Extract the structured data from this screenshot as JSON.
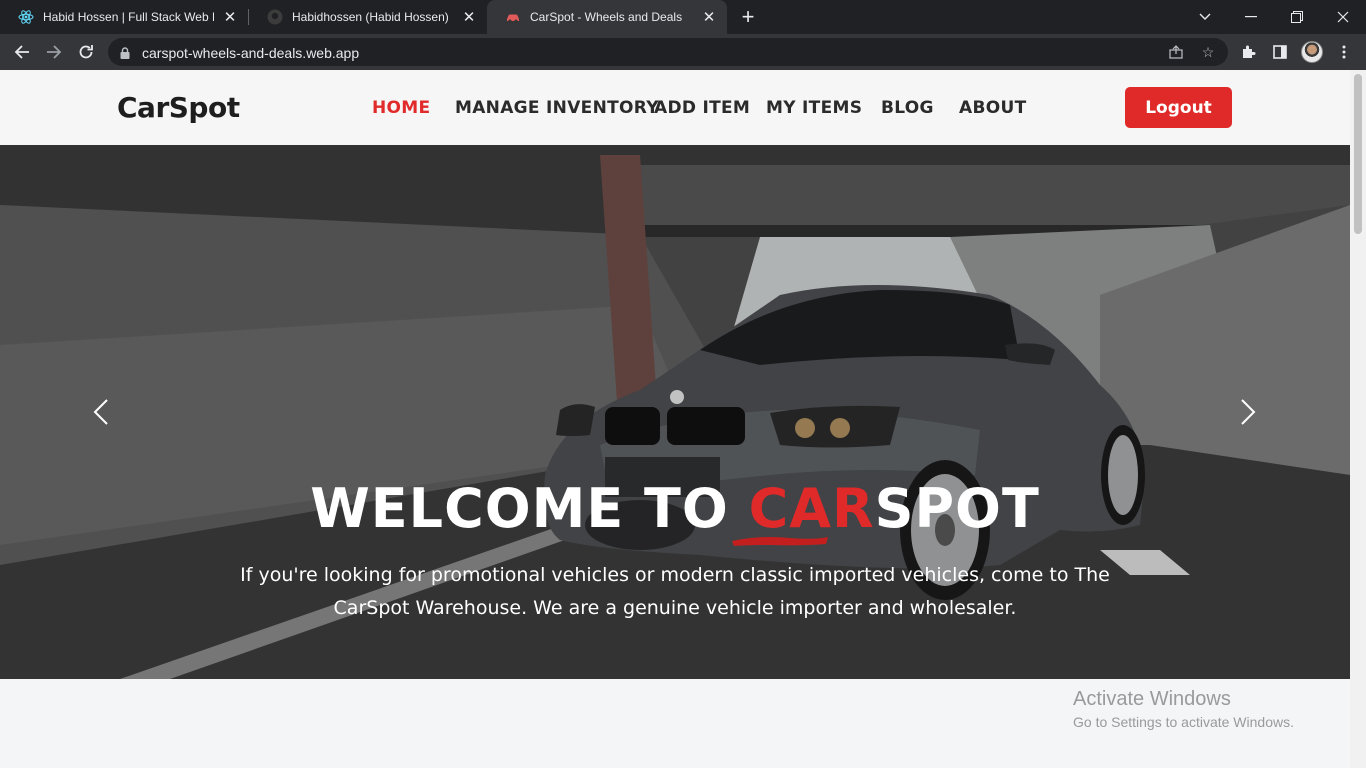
{
  "browser": {
    "tabs": [
      {
        "title": "Habid Hossen | Full Stack Web De",
        "icon": "react-icon"
      },
      {
        "title": "Habidhossen (Habid Hossen)",
        "icon": "github-icon"
      },
      {
        "title": "CarSpot - Wheels and Deals",
        "icon": "car-icon",
        "active": true
      }
    ],
    "url": "carspot-wheels-and-deals.web.app"
  },
  "header": {
    "brand": "CarSpot",
    "nav": [
      "HOME",
      "MANAGE INVENTORY",
      "ADD ITEM",
      "MY ITEMS",
      "BLOG",
      "ABOUT"
    ],
    "active_nav": "HOME",
    "logout_label": "Logout"
  },
  "hero": {
    "title_prefix": "WELCOME TO ",
    "title_highlight": "CAR",
    "title_suffix": "SPOT",
    "description": "If you're looking for promotional vehicles or modern classic imported vehicles, come to The CarSpot Warehouse. We are a genuine vehicle importer and wholesaler."
  },
  "watermark": {
    "line1": "Activate Windows",
    "line2": "Go to Settings to activate Windows."
  },
  "colors": {
    "accent": "#e02a2a",
    "header_bg": "#f6f6f6",
    "chrome_dark": "#202124",
    "chrome_toolbar": "#35363a"
  }
}
